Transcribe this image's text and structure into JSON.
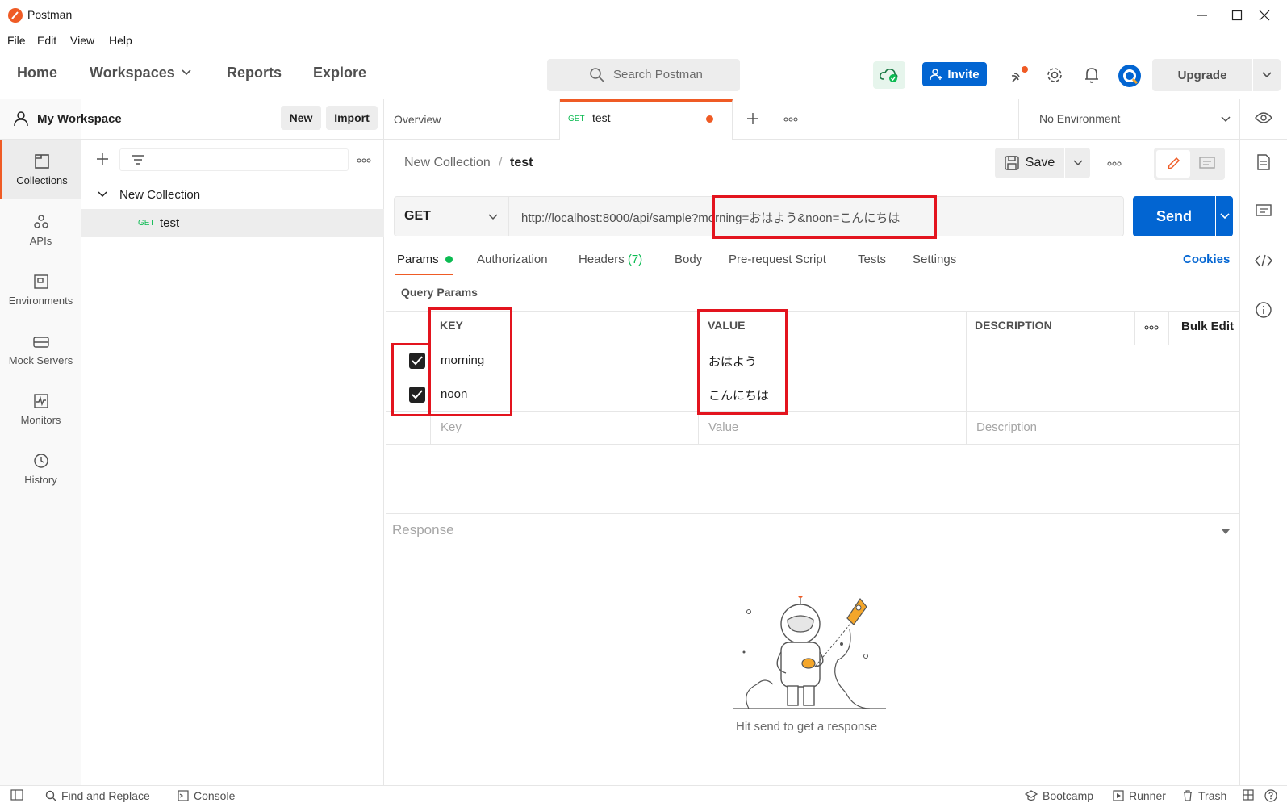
{
  "window": {
    "title": "Postman"
  },
  "menu": [
    "File",
    "Edit",
    "View",
    "Help"
  ],
  "nav": {
    "home": "Home",
    "workspaces": "Workspaces",
    "reports": "Reports",
    "explore": "Explore"
  },
  "search": {
    "placeholder": "Search Postman"
  },
  "header": {
    "invite": "Invite",
    "upgrade": "Upgrade"
  },
  "workspace": {
    "name": "My Workspace",
    "new": "New",
    "import": "Import"
  },
  "rail": [
    "Collections",
    "APIs",
    "Environments",
    "Mock Servers",
    "Monitors",
    "History"
  ],
  "tree": {
    "collection": "New Collection",
    "request_method": "GET",
    "request_name": "test"
  },
  "tabs": {
    "overview": "Overview",
    "active_method": "GET",
    "active_name": "test",
    "environment": "No Environment"
  },
  "breadcrumb": {
    "collection": "New Collection",
    "separator": "/",
    "request": "test"
  },
  "toolbar": {
    "save": "Save"
  },
  "request": {
    "method": "GET",
    "url": "http://localhost:8000/api/sample?morning=おはよう&noon=こんにちは",
    "send": "Send"
  },
  "request_tabs": {
    "params": "Params",
    "authorization": "Authorization",
    "headers": "Headers",
    "headers_count": "(7)",
    "body": "Body",
    "prerequest": "Pre-request Script",
    "tests": "Tests",
    "settings": "Settings",
    "cookies": "Cookies"
  },
  "query_params": {
    "title": "Query Params",
    "columns": {
      "key": "KEY",
      "value": "VALUE",
      "description": "DESCRIPTION",
      "bulk_edit": "Bulk Edit"
    },
    "rows": [
      {
        "key": "morning",
        "value": "おはよう",
        "description": "",
        "checked": true
      },
      {
        "key": "noon",
        "value": "こんにちは",
        "description": "",
        "checked": true
      }
    ],
    "placeholders": {
      "key": "Key",
      "value": "Value",
      "description": "Description"
    }
  },
  "response": {
    "title": "Response",
    "hint": "Hit send to get a response"
  },
  "statusbar": {
    "find_replace": "Find and Replace",
    "console": "Console",
    "bootcamp": "Bootcamp",
    "runner": "Runner",
    "trash": "Trash"
  },
  "colors": {
    "accent": "#ef5b25",
    "primary": "#0265d2",
    "highlight": "#e3141e",
    "get": "#0cbb52"
  }
}
